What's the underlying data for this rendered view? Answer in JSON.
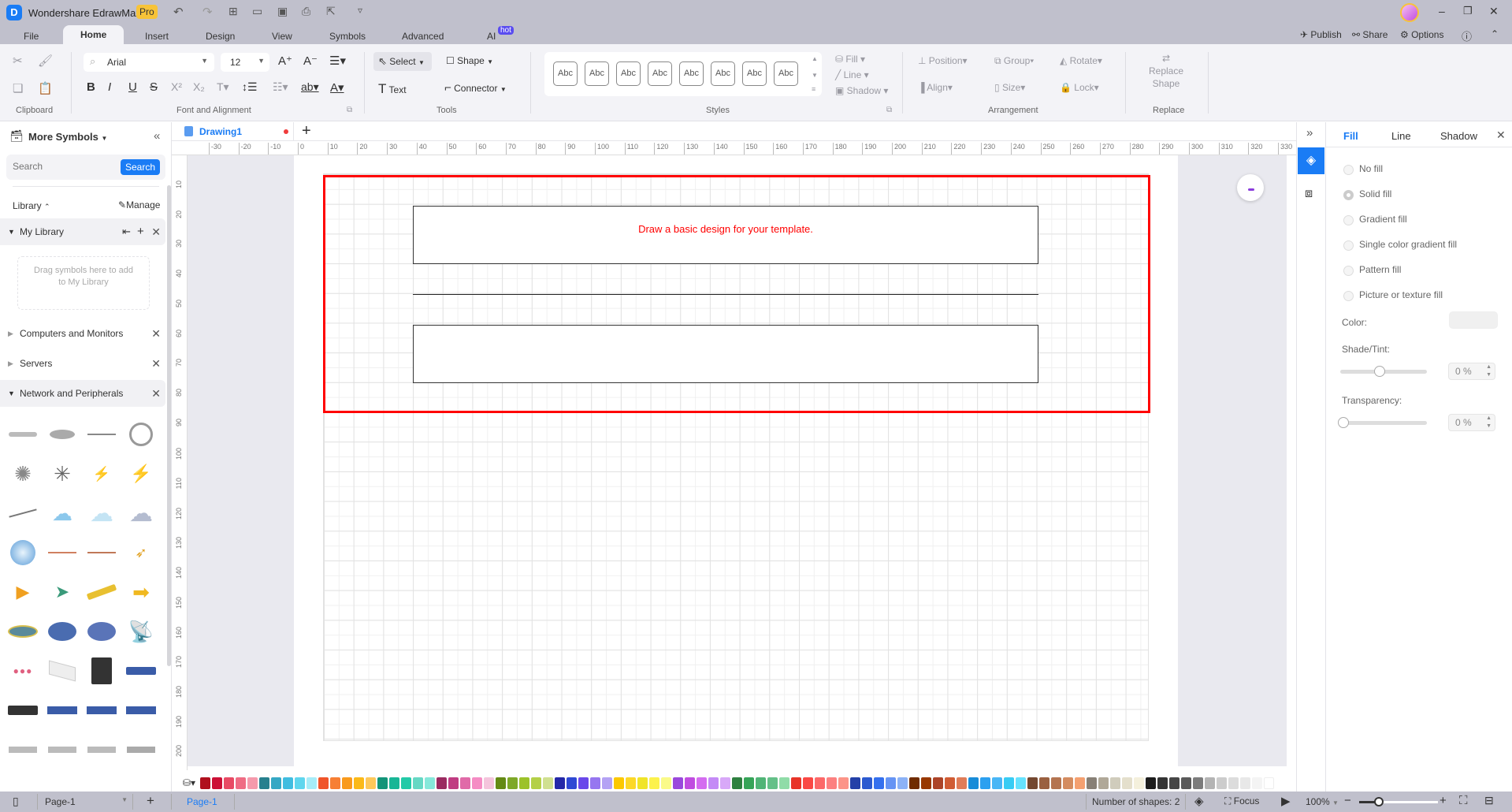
{
  "app": {
    "title": "Wondershare EdrawMax",
    "badge": "Pro"
  },
  "menu_tabs": [
    {
      "label": "File"
    },
    {
      "label": "Home"
    },
    {
      "label": "Insert"
    },
    {
      "label": "Design"
    },
    {
      "label": "View"
    },
    {
      "label": "Symbols"
    },
    {
      "label": "Advanced"
    },
    {
      "label": "AI"
    }
  ],
  "ai_badge": "hot",
  "header_actions": {
    "publish": "Publish",
    "share": "Share",
    "options": "Options"
  },
  "ribbon": {
    "clipboard_label": "Clipboard",
    "font": {
      "family": "Arial",
      "size": "12"
    },
    "font_group_label": "Font and Alignment",
    "tools": {
      "select": "Select",
      "shape": "Shape",
      "text": "Text",
      "connector": "Connector",
      "label": "Tools"
    },
    "styles": {
      "items": [
        "Abc",
        "Abc",
        "Abc",
        "Abc",
        "Abc",
        "Abc",
        "Abc",
        "Abc"
      ],
      "label": "Styles"
    },
    "fill": "Fill",
    "line": "Line",
    "shadow": "Shadow",
    "arrangement": {
      "position": "Position",
      "group": "Group",
      "rotate": "Rotate",
      "align": "Align",
      "size": "Size",
      "lock": "Lock",
      "label": "Arrangement"
    },
    "replace": {
      "button": "Replace Shape",
      "label": "Replace"
    }
  },
  "left_panel": {
    "title": "More Symbols",
    "search_placeholder": "Search",
    "search_button": "Search",
    "library_label": "Library",
    "manage_label": "Manage",
    "my_library": "My Library",
    "drop_hint": "Drag symbols here to add to My Library",
    "libraries": [
      {
        "label": "Computers and Monitors"
      },
      {
        "label": "Servers"
      },
      {
        "label": "Network and Peripherals"
      }
    ]
  },
  "document": {
    "tab": "Drawing1",
    "unsaved": true
  },
  "ruler": {
    "h": [
      "-30",
      "-20",
      "-10",
      "0",
      "10",
      "20",
      "30",
      "40",
      "50",
      "60",
      "70",
      "80",
      "90",
      "100",
      "110",
      "120",
      "130",
      "140",
      "150",
      "160",
      "170",
      "180",
      "190",
      "200",
      "210",
      "220",
      "230",
      "240",
      "250",
      "260",
      "270",
      "280",
      "290",
      "300",
      "310",
      "320",
      "330"
    ],
    "v": [
      "10",
      "20",
      "30",
      "40",
      "50",
      "60",
      "70",
      "80",
      "90",
      "100",
      "110",
      "120",
      "130",
      "140",
      "150",
      "160",
      "170",
      "180",
      "190",
      "200"
    ]
  },
  "canvas": {
    "instruction": "Draw a basic design for your template.",
    "highlight_color": "#ff0000",
    "text_color": "#ff0000"
  },
  "palette": [
    "#b0101e",
    "#cc1036",
    "#e84a64",
    "#ef6c84",
    "#f59aac",
    "#27808e",
    "#35a8c4",
    "#40bde0",
    "#5fd6ee",
    "#a6ecf8",
    "#f0542a",
    "#f77f34",
    "#f99a1c",
    "#fbb918",
    "#fdc85a",
    "#129478",
    "#18b696",
    "#23caa8",
    "#66d8c4",
    "#86e8da",
    "#9a2a60",
    "#c03c82",
    "#e06aa8",
    "#f58cc4",
    "#f4c4dc",
    "#648a14",
    "#7ea828",
    "#9cc22a",
    "#b4d048",
    "#d0e090",
    "#2428a8",
    "#2e48d4",
    "#6a48ea",
    "#9676f0",
    "#b4a2f4",
    "#fcc800",
    "#fcd828",
    "#f0e428",
    "#fcf24c",
    "#fafa88",
    "#9a48dc",
    "#c04ce0",
    "#d46cf0",
    "#c48af6",
    "#d8a8f8",
    "#2e8040",
    "#36a458",
    "#50b476",
    "#64c088",
    "#90dca8",
    "#e83428",
    "#fa4844",
    "#fc6868",
    "#fc8080",
    "#fc9488",
    "#2440a8",
    "#2c5ad0",
    "#3470ee",
    "#6694f4",
    "#8cb2f6",
    "#702c00",
    "#983800",
    "#ac4428",
    "#d05c34",
    "#e07c58",
    "#188cd8",
    "#2ca0f0",
    "#48b6f6",
    "#38ccf4",
    "#66e2fe",
    "#744830",
    "#9a6040",
    "#b47450",
    "#d48c60",
    "#f4a070",
    "#888076",
    "#b0a898",
    "#d0ccbc",
    "#e4dfcc",
    "#f4f0dc",
    "#1c1c1c",
    "#343434",
    "#464646",
    "#5a5a5a",
    "#7c7c7c",
    "#b4b4b4",
    "#cccccc",
    "#dcdcdc",
    "#e8e8e8",
    "#f4f4f4",
    "#ffffff"
  ],
  "status": {
    "page_select": "Page-1",
    "page_tab": "Page-1",
    "shapes": "Number of shapes: 2",
    "focus": "Focus",
    "zoom": "100%",
    "zoom_percent": 100
  },
  "right_panel": {
    "tabs": [
      {
        "label": "Fill"
      },
      {
        "label": "Line"
      },
      {
        "label": "Shadow"
      }
    ],
    "options": [
      {
        "label": "No fill"
      },
      {
        "label": "Solid fill",
        "selected": true
      },
      {
        "label": "Gradient fill"
      },
      {
        "label": "Single color gradient fill"
      },
      {
        "label": "Pattern fill"
      },
      {
        "label": "Picture or texture fill"
      }
    ],
    "color_label": "Color:",
    "shade_label": "Shade/Tint:",
    "shade_value": "0 %",
    "shade_slider": 0.45,
    "transparency_label": "Transparency:",
    "transparency_value": "0 %",
    "transparency_slider": 0
  },
  "accent": "#1a7cf5"
}
